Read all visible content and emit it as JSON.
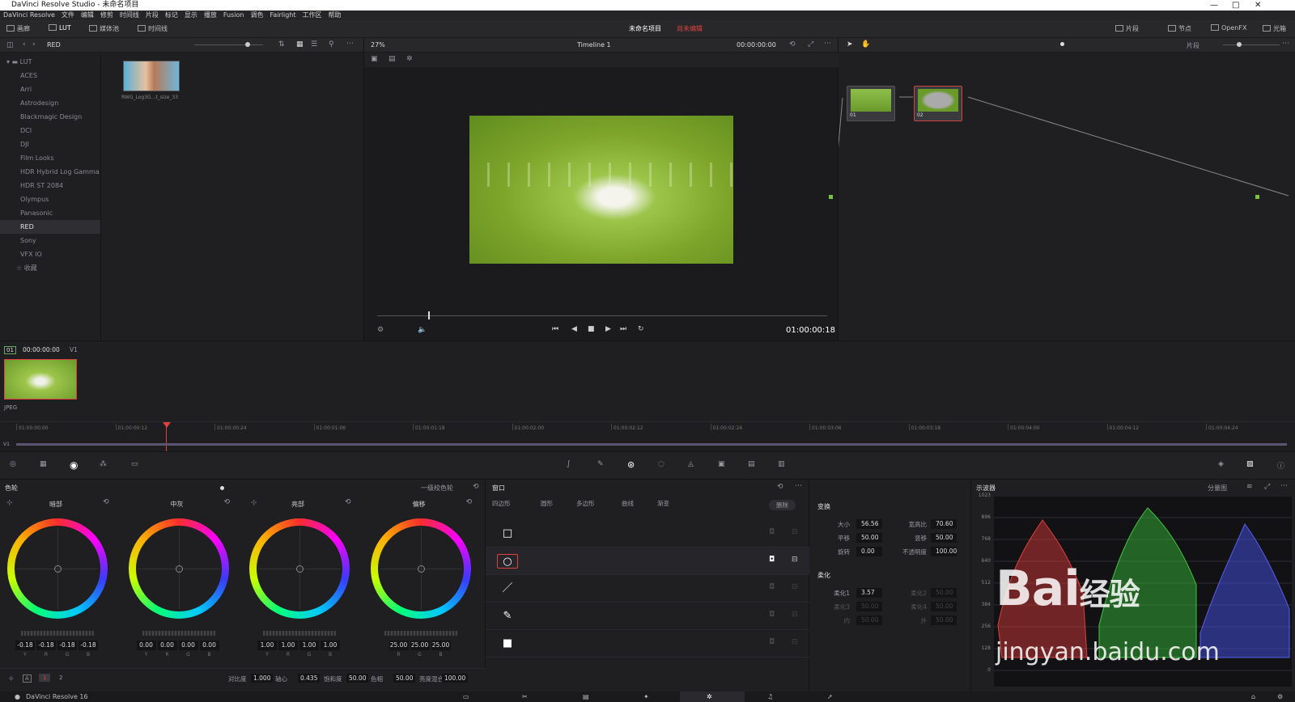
{
  "window": {
    "title": "DaVinci Resolve Studio - 未命名项目"
  },
  "menu": [
    "DaVinci Resolve",
    "文件",
    "编辑",
    "修剪",
    "时间线",
    "片段",
    "标记",
    "显示",
    "播放",
    "Fusion",
    "调色",
    "Fairlight",
    "工作区",
    "帮助"
  ],
  "toolbar": {
    "gallery": "画廊",
    "lut": "LUT",
    "media_pool": "媒体池",
    "timeline": "时间线",
    "project": "未命名项目",
    "status": "尚未编辑",
    "clips": "片段",
    "nodes": "节点",
    "openfx": "OpenFX",
    "library": "光箱"
  },
  "lut_browser": {
    "current": "RED",
    "root": "LUT",
    "items": [
      "ACES",
      "Arri",
      "Astrodesign",
      "Blackmagic Design",
      "DCI",
      "DJI",
      "Film Looks",
      "HDR Hybrid Log Gamma",
      "HDR ST 2084",
      "Olympus",
      "Panasonic",
      "RED",
      "Sony",
      "VFX IO"
    ],
    "selected": "RED",
    "favorites": "收藏",
    "thumb_label": "RWG_Log3G...t_size_33"
  },
  "viewer": {
    "zoom": "27%",
    "timeline": "Timeline 1",
    "timecode_top": "00:00:00:00",
    "timecode": "01:00:00:18",
    "mode": "片段"
  },
  "nodes": [
    {
      "label": "01"
    },
    {
      "label": "02"
    }
  ],
  "clips": {
    "index": "01",
    "timecode": "00:00:00:00",
    "track": "V1",
    "clip_type": "JPEG"
  },
  "ruler": {
    "ticks": [
      "01:00:00:00",
      "01:00:00:12",
      "01:00:00:24",
      "01:00:01:06",
      "01:00:01:18",
      "01:00:02:00",
      "01:00:02:12",
      "01:00:02:24",
      "01:00:03:06",
      "01:00:03:18",
      "01:00:04:00",
      "01:00:04:12",
      "01:00:04:24"
    ],
    "track": "V1"
  },
  "color_panel": {
    "title": "色轮",
    "mode": "一级校色轮",
    "wheels": [
      {
        "name": "暗部",
        "values": [
          "-0.18",
          "-0.18",
          "-0.18",
          "-0.18"
        ],
        "channels": [
          "Y",
          "R",
          "G",
          "B"
        ]
      },
      {
        "name": "中灰",
        "values": [
          "0.00",
          "0.00",
          "0.00",
          "0.00"
        ],
        "channels": [
          "Y",
          "R",
          "G",
          "B"
        ]
      },
      {
        "name": "亮部",
        "values": [
          "1.00",
          "1.00",
          "1.00",
          "1.00"
        ],
        "channels": [
          "Y",
          "R",
          "G",
          "B"
        ]
      },
      {
        "name": "偏移",
        "values": [
          "25.00",
          "25.00",
          "25.00"
        ],
        "channels": [
          "R",
          "G",
          "B"
        ]
      }
    ],
    "pages": [
      "1",
      "2"
    ],
    "bottom": [
      {
        "label": "对比度",
        "value": "1.000"
      },
      {
        "label": "轴心",
        "value": "0.435"
      },
      {
        "label": "饱和度",
        "value": "50.00"
      },
      {
        "label": "色相",
        "value": "50.00"
      },
      {
        "label": "亮度混合",
        "value": "100.00"
      }
    ]
  },
  "window_panel": {
    "title": "窗口",
    "tools": [
      "四边形",
      "圆形",
      "多边形",
      "曲线",
      "渐变"
    ],
    "delete": "删除"
  },
  "transform": {
    "title": "变换",
    "fields": [
      {
        "label": "大小",
        "value": "56.56"
      },
      {
        "label": "宽高比",
        "value": "70.60"
      },
      {
        "label": "平移",
        "value": "50.00"
      },
      {
        "label": "竖移",
        "value": "50.00"
      },
      {
        "label": "旋转",
        "value": "0.00"
      },
      {
        "label": "不透明度",
        "value": "100.00"
      }
    ],
    "soft_title": "柔化",
    "soft": [
      {
        "label": "柔化1",
        "value": "3.57"
      },
      {
        "label": "柔化2",
        "value": "50.00"
      },
      {
        "label": "柔化3",
        "value": "50.00"
      },
      {
        "label": "柔化4",
        "value": "50.00"
      },
      {
        "label": "内",
        "value": "50.00"
      },
      {
        "label": "外",
        "value": "50.00"
      }
    ]
  },
  "scope": {
    "title": "示波器",
    "mode": "分量图",
    "ticks": [
      "1023",
      "896",
      "768",
      "640",
      "512",
      "384",
      "256",
      "128",
      "0"
    ]
  },
  "status": {
    "app": "DaVinci Resolve 16"
  },
  "watermark": {
    "line1": "Bai",
    "line2": "经验",
    "line3": "jingyan.baidu.com"
  },
  "colors": {
    "accent": "#e04040",
    "bg": "#1f1f22"
  }
}
